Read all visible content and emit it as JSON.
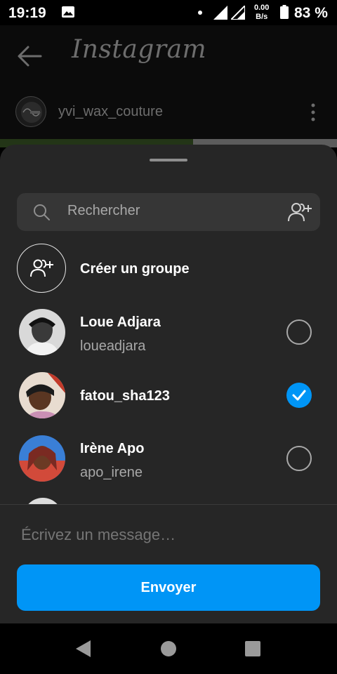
{
  "status": {
    "time": "19:19",
    "net_speed_value": "0.00",
    "net_speed_unit": "B/s",
    "battery": "83 %"
  },
  "header": {
    "app_name": "Instagram",
    "profile_username": "yvi_wax_couture"
  },
  "share_sheet": {
    "search_placeholder": "Rechercher",
    "create_group_label": "Créer un groupe",
    "contacts": [
      {
        "name": "Loue Adjara",
        "username": "loueadjara",
        "selected": false
      },
      {
        "name": "fatou_sha123",
        "username": "",
        "selected": true
      },
      {
        "name": "Irène Apo",
        "username": "apo_irene",
        "selected": false
      }
    ],
    "message_placeholder": "Écrivez un message…",
    "send_label": "Envoyer"
  },
  "colors": {
    "accent": "#0095f6",
    "sheet_background": "#262626",
    "search_background": "#363636",
    "secondary_text": "#a8a8a8"
  },
  "icons": [
    "gallery-icon",
    "signal-icon",
    "battery-icon",
    "back-arrow-icon",
    "more-options-icon",
    "search-icon",
    "add-people-icon",
    "group-icon",
    "check-icon",
    "nav-back-icon",
    "nav-home-icon",
    "nav-recents-icon"
  ]
}
